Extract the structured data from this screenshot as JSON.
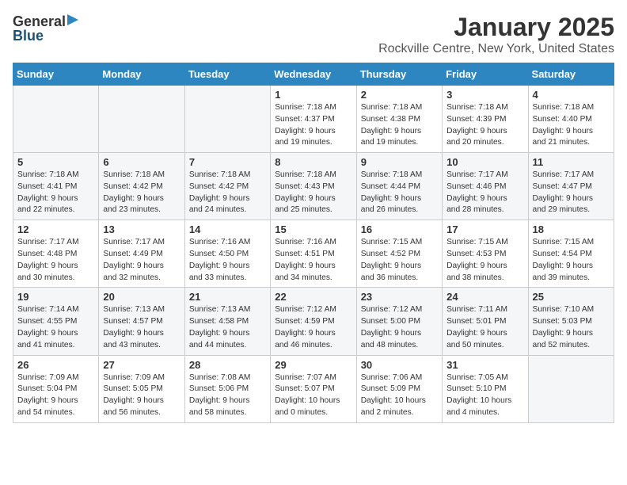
{
  "logo": {
    "general": "General",
    "blue": "Blue"
  },
  "title": "January 2025",
  "location": "Rockville Centre, New York, United States",
  "days_of_week": [
    "Sunday",
    "Monday",
    "Tuesday",
    "Wednesday",
    "Thursday",
    "Friday",
    "Saturday"
  ],
  "weeks": [
    [
      {
        "day": "",
        "info": ""
      },
      {
        "day": "",
        "info": ""
      },
      {
        "day": "",
        "info": ""
      },
      {
        "day": "1",
        "info": "Sunrise: 7:18 AM\nSunset: 4:37 PM\nDaylight: 9 hours\nand 19 minutes."
      },
      {
        "day": "2",
        "info": "Sunrise: 7:18 AM\nSunset: 4:38 PM\nDaylight: 9 hours\nand 19 minutes."
      },
      {
        "day": "3",
        "info": "Sunrise: 7:18 AM\nSunset: 4:39 PM\nDaylight: 9 hours\nand 20 minutes."
      },
      {
        "day": "4",
        "info": "Sunrise: 7:18 AM\nSunset: 4:40 PM\nDaylight: 9 hours\nand 21 minutes."
      }
    ],
    [
      {
        "day": "5",
        "info": "Sunrise: 7:18 AM\nSunset: 4:41 PM\nDaylight: 9 hours\nand 22 minutes."
      },
      {
        "day": "6",
        "info": "Sunrise: 7:18 AM\nSunset: 4:42 PM\nDaylight: 9 hours\nand 23 minutes."
      },
      {
        "day": "7",
        "info": "Sunrise: 7:18 AM\nSunset: 4:42 PM\nDaylight: 9 hours\nand 24 minutes."
      },
      {
        "day": "8",
        "info": "Sunrise: 7:18 AM\nSunset: 4:43 PM\nDaylight: 9 hours\nand 25 minutes."
      },
      {
        "day": "9",
        "info": "Sunrise: 7:18 AM\nSunset: 4:44 PM\nDaylight: 9 hours\nand 26 minutes."
      },
      {
        "day": "10",
        "info": "Sunrise: 7:17 AM\nSunset: 4:46 PM\nDaylight: 9 hours\nand 28 minutes."
      },
      {
        "day": "11",
        "info": "Sunrise: 7:17 AM\nSunset: 4:47 PM\nDaylight: 9 hours\nand 29 minutes."
      }
    ],
    [
      {
        "day": "12",
        "info": "Sunrise: 7:17 AM\nSunset: 4:48 PM\nDaylight: 9 hours\nand 30 minutes."
      },
      {
        "day": "13",
        "info": "Sunrise: 7:17 AM\nSunset: 4:49 PM\nDaylight: 9 hours\nand 32 minutes."
      },
      {
        "day": "14",
        "info": "Sunrise: 7:16 AM\nSunset: 4:50 PM\nDaylight: 9 hours\nand 33 minutes."
      },
      {
        "day": "15",
        "info": "Sunrise: 7:16 AM\nSunset: 4:51 PM\nDaylight: 9 hours\nand 34 minutes."
      },
      {
        "day": "16",
        "info": "Sunrise: 7:15 AM\nSunset: 4:52 PM\nDaylight: 9 hours\nand 36 minutes."
      },
      {
        "day": "17",
        "info": "Sunrise: 7:15 AM\nSunset: 4:53 PM\nDaylight: 9 hours\nand 38 minutes."
      },
      {
        "day": "18",
        "info": "Sunrise: 7:15 AM\nSunset: 4:54 PM\nDaylight: 9 hours\nand 39 minutes."
      }
    ],
    [
      {
        "day": "19",
        "info": "Sunrise: 7:14 AM\nSunset: 4:55 PM\nDaylight: 9 hours\nand 41 minutes."
      },
      {
        "day": "20",
        "info": "Sunrise: 7:13 AM\nSunset: 4:57 PM\nDaylight: 9 hours\nand 43 minutes."
      },
      {
        "day": "21",
        "info": "Sunrise: 7:13 AM\nSunset: 4:58 PM\nDaylight: 9 hours\nand 44 minutes."
      },
      {
        "day": "22",
        "info": "Sunrise: 7:12 AM\nSunset: 4:59 PM\nDaylight: 9 hours\nand 46 minutes."
      },
      {
        "day": "23",
        "info": "Sunrise: 7:12 AM\nSunset: 5:00 PM\nDaylight: 9 hours\nand 48 minutes."
      },
      {
        "day": "24",
        "info": "Sunrise: 7:11 AM\nSunset: 5:01 PM\nDaylight: 9 hours\nand 50 minutes."
      },
      {
        "day": "25",
        "info": "Sunrise: 7:10 AM\nSunset: 5:03 PM\nDaylight: 9 hours\nand 52 minutes."
      }
    ],
    [
      {
        "day": "26",
        "info": "Sunrise: 7:09 AM\nSunset: 5:04 PM\nDaylight: 9 hours\nand 54 minutes."
      },
      {
        "day": "27",
        "info": "Sunrise: 7:09 AM\nSunset: 5:05 PM\nDaylight: 9 hours\nand 56 minutes."
      },
      {
        "day": "28",
        "info": "Sunrise: 7:08 AM\nSunset: 5:06 PM\nDaylight: 9 hours\nand 58 minutes."
      },
      {
        "day": "29",
        "info": "Sunrise: 7:07 AM\nSunset: 5:07 PM\nDaylight: 10 hours\nand 0 minutes."
      },
      {
        "day": "30",
        "info": "Sunrise: 7:06 AM\nSunset: 5:09 PM\nDaylight: 10 hours\nand 2 minutes."
      },
      {
        "day": "31",
        "info": "Sunrise: 7:05 AM\nSunset: 5:10 PM\nDaylight: 10 hours\nand 4 minutes."
      },
      {
        "day": "",
        "info": ""
      }
    ]
  ]
}
